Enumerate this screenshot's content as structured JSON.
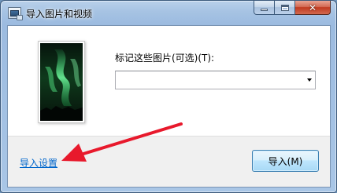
{
  "window": {
    "title": "导入图片和视频",
    "app_icon": "import-photos-icon",
    "controls": {
      "minimize": "minimize-icon",
      "maximize": "maximize-icon",
      "close": "close-icon"
    }
  },
  "tag": {
    "label": "标记这些图片(可选)(T):",
    "value": "",
    "placeholder": "",
    "dropdown_icon": "chevron-down-icon"
  },
  "footer": {
    "import_settings_link": "导入设置",
    "import_button": "导入(M)"
  },
  "annotation": {
    "arrow_color": "#e8192c"
  },
  "colors": {
    "link": "#0066cc",
    "button_border": "#3c7fb1"
  }
}
